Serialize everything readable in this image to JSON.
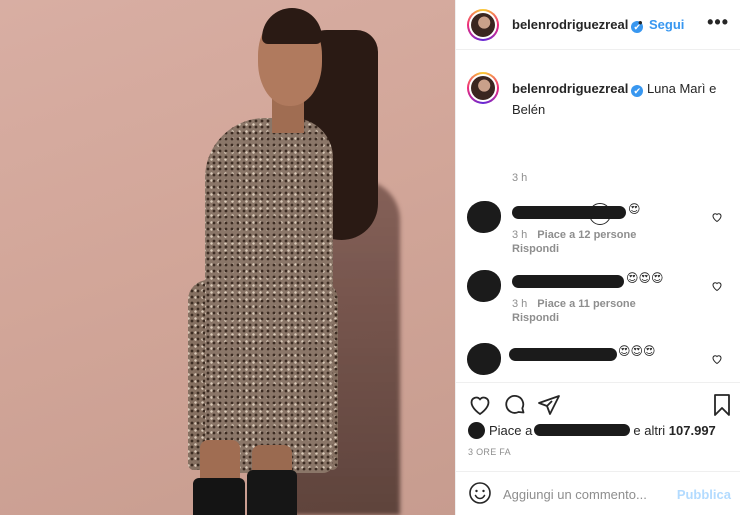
{
  "header": {
    "username": "belenrodriguezreal",
    "verified_mark": "✔",
    "separator": "•",
    "follow_label": "Segui",
    "more_label": "•••"
  },
  "caption": {
    "username": "belenrodriguezreal",
    "verified_mark": "✔",
    "text": "Luna Marì e Belén",
    "time": "3 h"
  },
  "comments": [
    {
      "emoji": "😍",
      "time": "3 h",
      "likes": "Piace a 12 persone",
      "reply": "Rispondi"
    },
    {
      "emoji": "😍😍😍",
      "time": "3 h",
      "likes": "Piace a 11 persone",
      "reply": "Rispondi"
    },
    {
      "emoji": "😍😍😍",
      "time": "",
      "likes": "",
      "reply": ""
    }
  ],
  "actions": {
    "likes_prefix": "Piace a",
    "likes_suffix": "e altri",
    "likes_count": "107.997",
    "timestamp": "3 ORE FA",
    "add_comment_placeholder": "Aggiungi un commento...",
    "publish_label": "Pubblica"
  },
  "icons": [
    "heart-icon",
    "comment-icon",
    "share-icon",
    "bookmark-icon",
    "smile-icon",
    "plus-circle-icon",
    "more-icon",
    "verified-icon"
  ],
  "colors": {
    "link_blue": "#3897f0",
    "publish_disabled": "#b3dbff",
    "muted": "#8e8e8e",
    "text": "#262626"
  }
}
